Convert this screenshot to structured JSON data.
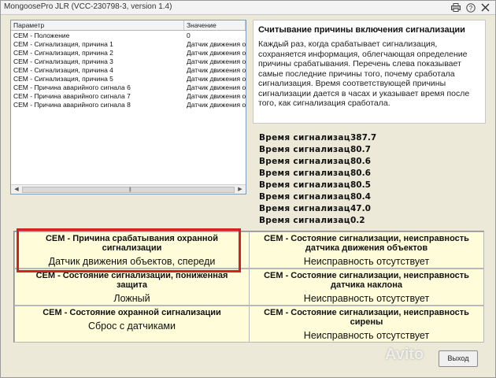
{
  "window": {
    "title": "MongoosePro JLR  (VCC-230798-3, version 1.4)"
  },
  "list": {
    "headers": {
      "param": "Параметр",
      "value": "Значение"
    },
    "rows": [
      {
        "param": "CEM - Положение",
        "value": "0"
      },
      {
        "param": "CEM - Сигнализация, причина 1",
        "value": "Датчик движения объ"
      },
      {
        "param": "CEM - Сигнализация, причина 2",
        "value": "Датчик движения объ"
      },
      {
        "param": "CEM - Сигнализация, причина 3",
        "value": "Датчик движения объ"
      },
      {
        "param": "CEM - Сигнализация, причина 4",
        "value": "Датчик движения объ"
      },
      {
        "param": "CEM - Сигнализация, причина 5",
        "value": "Датчик движения объ"
      },
      {
        "param": "CEM - Причина аварийного сигнала 6",
        "value": "Датчик движения объ"
      },
      {
        "param": "CEM - Причина аварийного сигнала 7",
        "value": "Датчик движения объ"
      },
      {
        "param": "CEM - Причина аварийного сигнала 8",
        "value": "Датчик движения объ"
      }
    ]
  },
  "description": {
    "title": "Считывание причины включения сигнализации",
    "text": "Каждый раз, когда срабатывает сигнализация, сохраняется информация, облегчающая определение причины срабатывания. Перечень слева показывает самые последние причины того, почему сработала сигнализация. Время соответствующей причины сигнализации дается в часах и указывает время после того, как сигнализация сработала."
  },
  "times": [
    {
      "label": "Время сигнализац",
      "value": "387.7"
    },
    {
      "label": "Время сигнализац",
      "value": "80.7"
    },
    {
      "label": "Время сигнализац",
      "value": "80.6"
    },
    {
      "label": "Время сигнализац",
      "value": "80.6"
    },
    {
      "label": "Время сигнализац",
      "value": "80.5"
    },
    {
      "label": "Время сигнализац",
      "value": "80.4"
    },
    {
      "label": "Время сигнализац",
      "value": "47.0"
    },
    {
      "label": "Время сигнализац",
      "value": "0.2"
    }
  ],
  "status": {
    "cells": [
      {
        "title": "CEM - Причина срабатывания охранной сигнализации",
        "value": "Датчик движения объектов, спереди"
      },
      {
        "title": "CEM - Состояние сигнализации, неисправность датчика движения объектов",
        "value": "Неисправность отсутствует"
      },
      {
        "title": "CEM - Состояние сигнализации, пониженная защита",
        "value": "Ложный"
      },
      {
        "title": "CEM - Состояние сигнализации, неисправность датчика наклона",
        "value": "Неисправность отсутствует"
      },
      {
        "title": "CEM - Состояние охранной сигнализации",
        "value": "Сброс с датчиками"
      },
      {
        "title": "CEM - Состояние сигнализации, неисправность сирены",
        "value": "Неисправность отсутствует"
      }
    ]
  },
  "buttons": {
    "exit": "Выход"
  },
  "watermark": "Avito",
  "colors": {
    "highlight": "#d32020",
    "status_bg": "#fffdd9"
  },
  "icons": [
    "printer-icon",
    "help-icon",
    "close-icon"
  ]
}
